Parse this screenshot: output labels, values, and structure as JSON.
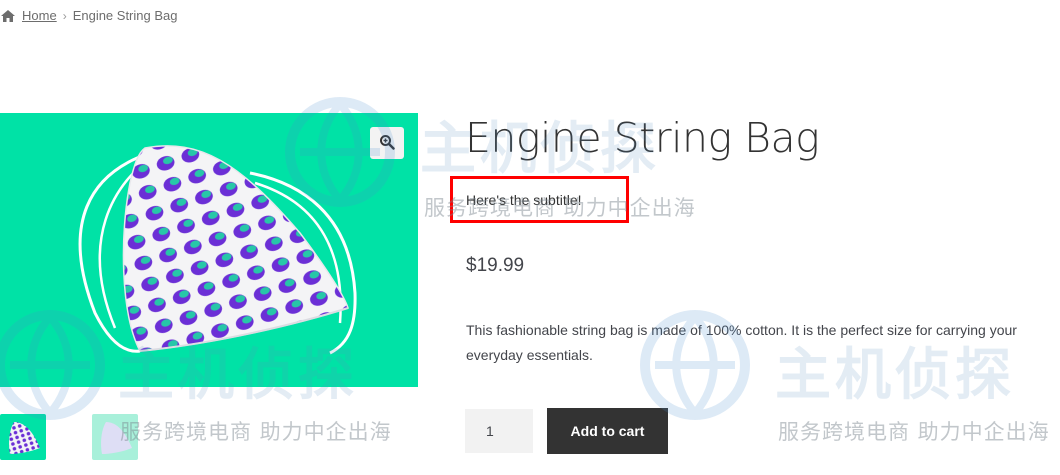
{
  "breadcrumb": {
    "home_icon": "home-icon",
    "home_label": "Home",
    "separator": "›",
    "current": "Engine String Bag"
  },
  "product": {
    "title": "Engine String Bag",
    "subtitle": "Here's the subtitle!",
    "price": "$19.99",
    "description": "This fashionable string bag is made of 100% cotton. It is the perfect size for carrying your everyday essentials.",
    "quantity": "1",
    "add_to_cart_label": "Add to cart",
    "zoom_icon": "zoom-in-icon"
  },
  "watermark": {
    "brand": "主机侦探",
    "tagline": "服务跨境电商 助力中企出海"
  },
  "colors": {
    "image_bg": "#00e2a6",
    "button_bg": "#333333",
    "highlight_border": "#ff0000",
    "pattern_purple": "#6b2fd6"
  }
}
